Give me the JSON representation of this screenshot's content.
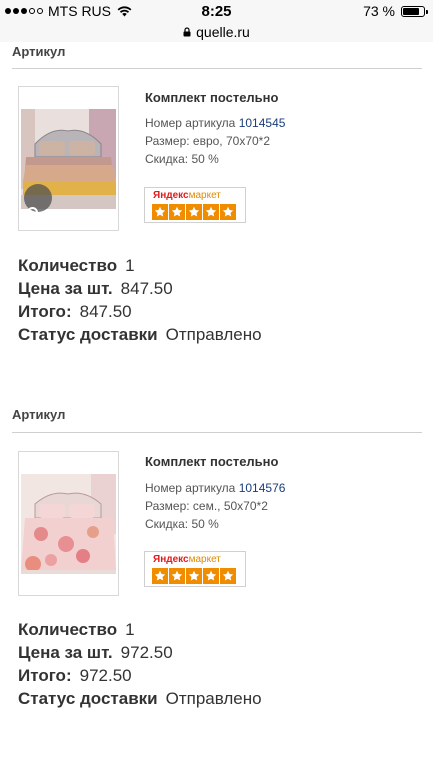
{
  "status_bar": {
    "carrier": "MTS RUS",
    "time": "8:25",
    "battery": "73 %"
  },
  "browser": {
    "url": "quelle.ru"
  },
  "orders": [
    {
      "section_title": "Артикул",
      "product_title": "Комплект постельно",
      "article_label": "Номер артикула",
      "article_number": "1014545",
      "size": "Размер: евро, 70x70*2",
      "discount": "Скидка: 50 %",
      "market_brand_ya": "Яндекс",
      "market_brand_mk": "маркет",
      "rating_stars": 5,
      "quantity_label": "Количество",
      "quantity": "1",
      "price_label": "Цена за шт.",
      "price": "847.50",
      "total_label": "Итого:",
      "total": "847.50",
      "delivery_label": "Статус доставки",
      "delivery_status": "Отправлено"
    },
    {
      "section_title": "Артикул",
      "product_title": "Комплект постельно",
      "article_label": "Номер артикула",
      "article_number": "1014576",
      "size": "Размер: сем., 50x70*2",
      "discount": "Скидка: 50 %",
      "market_brand_ya": "Яндекс",
      "market_brand_mk": "маркет",
      "rating_stars": 5,
      "quantity_label": "Количество",
      "quantity": "1",
      "price_label": "Цена за шт.",
      "price": "972.50",
      "total_label": "Итого:",
      "total": "972.50",
      "delivery_label": "Статус доставки",
      "delivery_status": "Отправлено"
    }
  ]
}
